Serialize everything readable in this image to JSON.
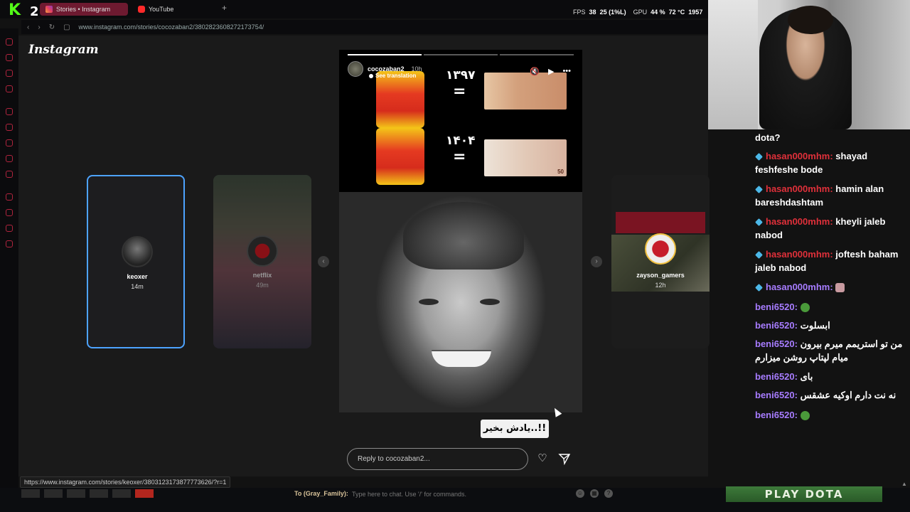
{
  "browser": {
    "tabs": [
      {
        "label": "Stories • Instagram",
        "active": true
      },
      {
        "label": "YouTube",
        "active": false
      }
    ],
    "new_tab": "+",
    "url": "www.instagram.com/stories/cocozaban2/3802823608272173754/",
    "perf": {
      "fps_label": "FPS",
      "fps": "38",
      "fps_low": "25 (1%L)",
      "gpu_label": "GPU",
      "gpu": "44 %",
      "temp": "72 °C",
      "clock": "1957"
    },
    "status_link": "https://www.instagram.com/stories/keoxer/3803123173877773626/?r=1"
  },
  "instagram": {
    "logo": "Instagram",
    "stories": [
      {
        "user": "keoxer",
        "time": "14m",
        "selected": true
      },
      {
        "user": "netflix",
        "time": "49m",
        "selected": false
      },
      {
        "user": "zayson_gamers",
        "time": "12h",
        "selected": false
      }
    ],
    "current": {
      "user": "cocozaban2",
      "time": "10h",
      "see_translation": "See translation",
      "years": [
        "۱۳۹۷",
        "۱۴۰۴"
      ],
      "equals": "=",
      "bill_value": "50",
      "caption": "یادش بخیر..!!",
      "reply_placeholder": "Reply to cocozaban2..."
    }
  },
  "chat": {
    "lines": [
      {
        "user": "",
        "text": "dota?"
      },
      {
        "user": "hasan000mhm",
        "text": "shayad feshfeshe bode"
      },
      {
        "user": "hasan000mhm",
        "text": "hamin alan bareshdashtam"
      },
      {
        "user": "hasan000mhm",
        "text": "kheyli jaleb nabod"
      },
      {
        "user": "hasan000mhm",
        "text": "joftesh baham jaleb nabod"
      },
      {
        "user": "hasan000mhm:",
        "text": ""
      },
      {
        "user": "beni6520:",
        "text": ""
      },
      {
        "user": "beni6520:",
        "text": "ابسلوت"
      },
      {
        "user": "beni6520:",
        "text": "من تو استریمم میرم بیرون میام لپتاپ روشن میزارم"
      },
      {
        "user": "beni6520:",
        "text": "بای"
      },
      {
        "user": "beni6520:",
        "text": "نه نت دارم اوکیه عشقس"
      },
      {
        "user": "beni6520:",
        "text": ""
      }
    ]
  },
  "game": {
    "chat_to": "To (Gray_Family):",
    "chat_placeholder": "Type here to chat. Use '/' for commands.",
    "help": "?",
    "play_button": "PLAY DOTA"
  },
  "colors": {
    "accent_red": "#e0303a",
    "accent_purple": "#a77cff",
    "story_ring": "#4da3ff",
    "play_green": "#3d7a3a"
  }
}
